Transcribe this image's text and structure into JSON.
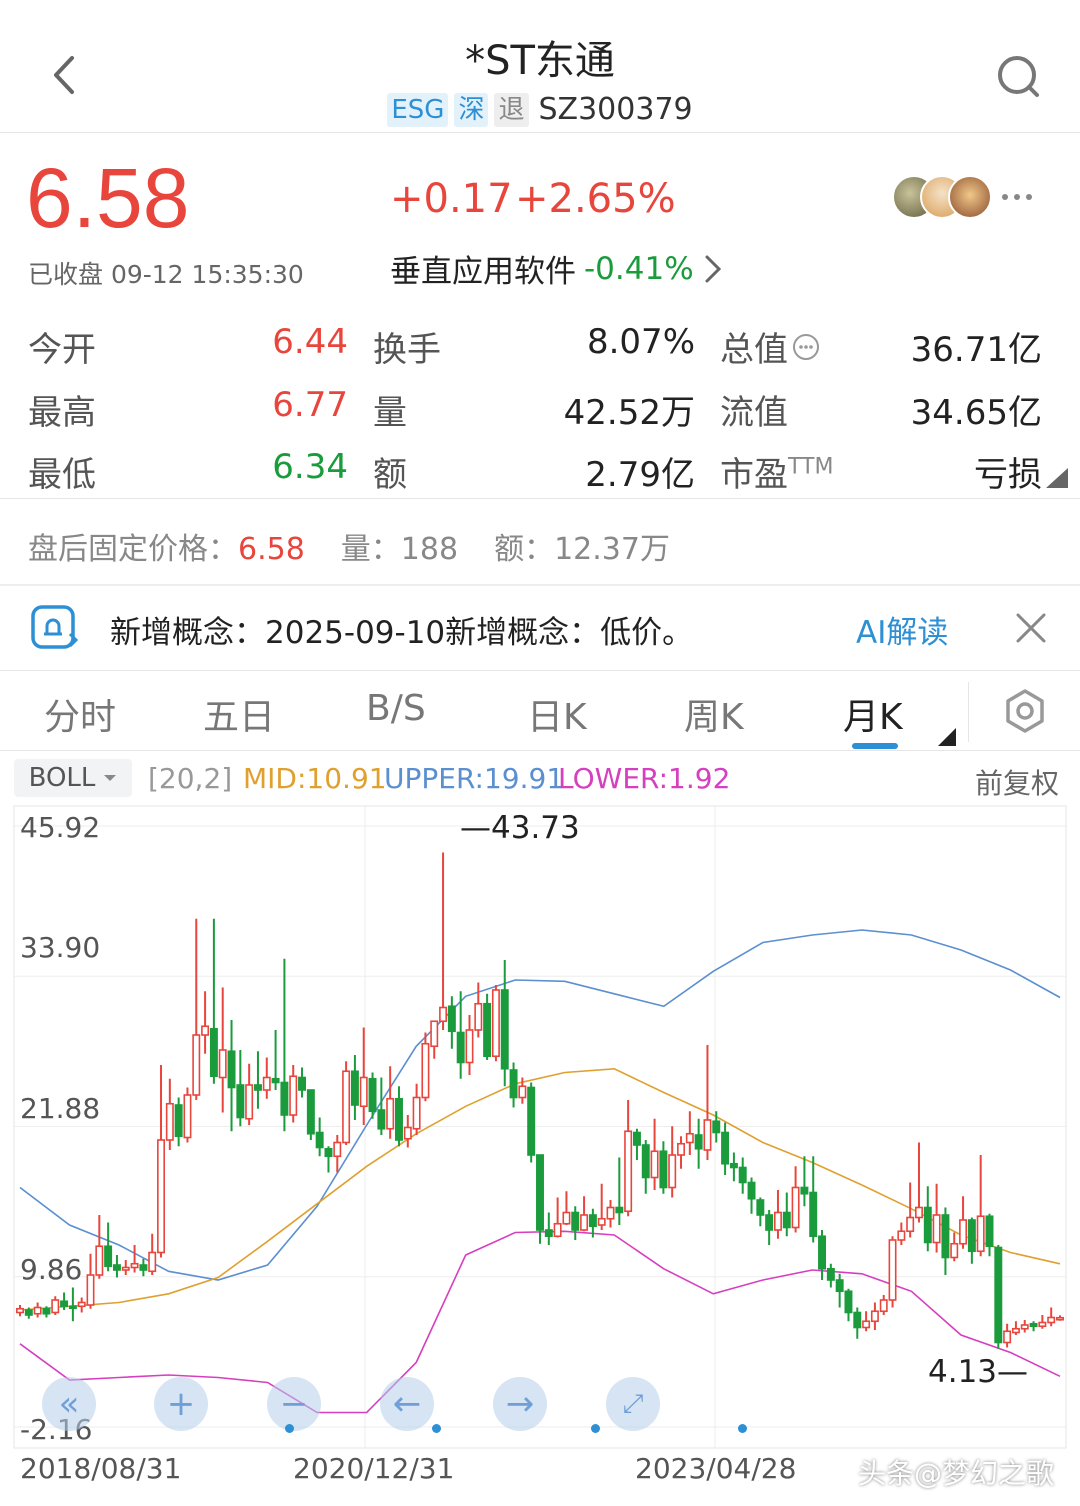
{
  "header": {
    "title": "*ST东通",
    "tags": [
      "ESG",
      "深",
      "退"
    ],
    "code": "SZ300379"
  },
  "quote": {
    "price": "6.58",
    "change": "+0.17",
    "change_pct": "+2.65%",
    "status": "已收盘 09-12 15:35:30",
    "sector_name": "垂直应用软件",
    "sector_change": "-0.41%"
  },
  "stats": [
    {
      "label": "今开",
      "value": "6.44",
      "color": "red"
    },
    {
      "label": "换手",
      "value": "8.07%",
      "color": "black"
    },
    {
      "label": "总值",
      "value": "36.71亿",
      "color": "black"
    },
    {
      "label": "最高",
      "value": "6.77",
      "color": "red"
    },
    {
      "label": "量",
      "value": "42.52万",
      "color": "black"
    },
    {
      "label": "流值",
      "value": "34.65亿",
      "color": "black"
    },
    {
      "label": "最低",
      "value": "6.34",
      "color": "green"
    },
    {
      "label": "额",
      "value": "2.79亿",
      "color": "black"
    },
    {
      "label": "市盈",
      "value": "亏损",
      "color": "black"
    }
  ],
  "ttm_sup": "TTM",
  "after_hours": {
    "label": "盘后固定价格：",
    "price": "6.58",
    "vol_label": "量：",
    "vol": "188",
    "amt_label": "额：",
    "amt": "12.37万"
  },
  "concept": {
    "text": "新增概念：2025-09-10新增概念：低价。",
    "ai_label": "AI解读"
  },
  "tabs": [
    "分时",
    "五日",
    "B/S",
    "日K",
    "周K",
    "月K"
  ],
  "active_tab": "月K",
  "indicator": {
    "name": "BOLL",
    "params": "[20,2]",
    "mid": "MID:10.91",
    "upper": "UPPER:19.91",
    "lower": "LOWER:1.92",
    "adjust": "前复权"
  },
  "colors": {
    "up": "#e8453c",
    "down": "#1a9b3c",
    "mid": "#e0a030",
    "upper": "#5b8fd0",
    "lower": "#d63fbf"
  },
  "chart_data": {
    "type": "candlestick",
    "y_ticks": [
      "45.92",
      "33.90",
      "21.88",
      "9.86",
      "-2.16"
    ],
    "ylim": [
      -2.16,
      45.92
    ],
    "x_ticks": [
      "2018/08/31",
      "2020/12/31",
      "2023/04/28"
    ],
    "max_label": "43.73",
    "min_label": "4.13",
    "candles": [
      [
        7.0,
        7.3,
        6.7,
        7.6
      ],
      [
        7.2,
        6.8,
        6.5,
        7.4
      ],
      [
        6.9,
        7.4,
        6.6,
        7.8
      ],
      [
        7.3,
        6.9,
        6.6,
        7.5
      ],
      [
        7.0,
        8.0,
        6.8,
        8.3
      ],
      [
        7.9,
        7.5,
        7.2,
        8.6
      ],
      [
        7.5,
        7.4,
        6.3,
        9.0
      ],
      [
        7.5,
        7.8,
        7.0,
        8.2
      ],
      [
        7.6,
        10.0,
        7.3,
        11.7
      ],
      [
        10.0,
        12.3,
        9.7,
        14.8
      ],
      [
        12.3,
        10.7,
        10.3,
        14.2
      ],
      [
        10.8,
        10.4,
        9.8,
        11.6
      ],
      [
        10.4,
        10.6,
        10.0,
        11.2
      ],
      [
        10.6,
        10.9,
        10.2,
        12.4
      ],
      [
        10.8,
        10.4,
        9.9,
        11.3
      ],
      [
        10.3,
        11.8,
        10.0,
        13.3
      ],
      [
        11.8,
        20.8,
        11.4,
        26.8
      ],
      [
        20.8,
        23.7,
        20.0,
        25.7
      ],
      [
        23.6,
        21.1,
        20.3,
        24.2
      ],
      [
        21.0,
        24.4,
        20.6,
        25.0
      ],
      [
        24.4,
        29.2,
        24.0,
        38.5
      ],
      [
        29.2,
        29.9,
        27.7,
        32.7
      ],
      [
        29.7,
        25.9,
        25.3,
        38.5
      ],
      [
        25.8,
        28.0,
        23.0,
        33.0
      ],
      [
        27.9,
        25.0,
        21.5,
        30.4
      ],
      [
        25.2,
        22.6,
        21.9,
        28.0
      ],
      [
        22.5,
        25.2,
        22.0,
        26.9
      ],
      [
        25.2,
        24.8,
        23.3,
        27.9
      ],
      [
        24.8,
        25.8,
        24.1,
        27.4
      ],
      [
        25.7,
        25.4,
        24.8,
        29.6
      ],
      [
        25.4,
        22.8,
        21.5,
        35.3
      ],
      [
        22.8,
        25.9,
        22.2,
        26.8
      ],
      [
        25.8,
        24.8,
        24.2,
        26.6
      ],
      [
        24.8,
        21.3,
        20.8,
        24.7
      ],
      [
        21.4,
        20.2,
        19.5,
        22.6
      ],
      [
        20.1,
        19.5,
        18.2,
        20.3
      ],
      [
        19.5,
        20.6,
        18.2,
        21.2
      ],
      [
        20.6,
        26.3,
        20.4,
        27.1
      ],
      [
        26.3,
        23.6,
        22.4,
        27.6
      ],
      [
        23.5,
        25.8,
        22.0,
        29.8
      ],
      [
        25.7,
        23.1,
        22.5,
        26.2
      ],
      [
        23.2,
        21.7,
        21.2,
        25.8
      ],
      [
        21.7,
        24.1,
        20.9,
        26.7
      ],
      [
        24.1,
        20.8,
        20.3,
        25.1
      ],
      [
        20.9,
        21.8,
        20.2,
        22.8
      ],
      [
        21.7,
        24.2,
        21.2,
        25.3
      ],
      [
        24.2,
        28.5,
        23.9,
        29.4
      ],
      [
        28.3,
        30.3,
        27.3,
        30.3
      ],
      [
        30.3,
        31.4,
        29.6,
        43.8
      ],
      [
        31.5,
        29.5,
        28.1,
        32.3
      ],
      [
        29.4,
        27.0,
        25.7,
        32.7
      ],
      [
        27.0,
        29.6,
        26.0,
        30.8
      ],
      [
        29.6,
        31.7,
        29.0,
        33.4
      ],
      [
        31.7,
        27.5,
        27.2,
        32.5
      ],
      [
        27.5,
        32.8,
        27.1,
        33.2
      ],
      [
        32.8,
        26.5,
        25.1,
        35.2
      ],
      [
        26.4,
        24.2,
        23.4,
        27.0
      ],
      [
        24.2,
        25.1,
        23.7,
        25.8
      ],
      [
        25.0,
        19.6,
        19.0,
        25.4
      ],
      [
        19.6,
        13.6,
        12.5,
        19.6
      ],
      [
        13.6,
        13.1,
        12.4,
        15.0
      ],
      [
        13.1,
        14.1,
        13.0,
        16.2
      ],
      [
        14.1,
        15.0,
        14.0,
        16.7
      ],
      [
        15.0,
        13.6,
        12.8,
        15.5
      ],
      [
        13.6,
        14.8,
        13.5,
        16.3
      ],
      [
        14.8,
        13.9,
        13.0,
        15.3
      ],
      [
        14.0,
        14.5,
        13.6,
        17.3
      ],
      [
        14.5,
        15.4,
        13.8,
        16.0
      ],
      [
        15.4,
        15.0,
        14.0,
        19.4
      ],
      [
        15.1,
        21.5,
        14.7,
        24.0
      ],
      [
        21.4,
        20.4,
        19.2,
        21.7
      ],
      [
        20.4,
        17.8,
        16.5,
        20.8
      ],
      [
        17.8,
        19.9,
        16.8,
        22.5
      ],
      [
        19.9,
        17.0,
        16.5,
        20.7
      ],
      [
        17.0,
        19.6,
        16.2,
        21.9
      ],
      [
        19.6,
        20.5,
        18.5,
        21.1
      ],
      [
        20.6,
        21.3,
        19.6,
        23.1
      ],
      [
        21.2,
        20.1,
        18.5,
        22.5
      ],
      [
        20.0,
        22.4,
        19.2,
        28.4
      ],
      [
        22.3,
        21.4,
        20.6,
        23.1
      ],
      [
        21.4,
        18.9,
        18.0,
        22.2
      ],
      [
        18.9,
        18.6,
        17.5,
        19.8
      ],
      [
        18.6,
        17.4,
        16.5,
        19.4
      ],
      [
        17.4,
        16.1,
        14.9,
        17.8
      ],
      [
        16.0,
        14.8,
        13.9,
        16.2
      ],
      [
        14.8,
        13.6,
        12.4,
        15.2
      ],
      [
        13.6,
        15.0,
        12.9,
        16.8
      ],
      [
        15.0,
        13.8,
        13.1,
        16.6
      ],
      [
        13.8,
        17.0,
        13.4,
        18.7
      ],
      [
        17.0,
        16.5,
        15.5,
        19.5
      ],
      [
        16.6,
        13.1,
        12.6,
        19.5
      ],
      [
        13.1,
        10.5,
        9.6,
        13.6
      ],
      [
        10.5,
        9.6,
        9.0,
        10.9
      ],
      [
        9.6,
        8.7,
        7.4,
        10.1
      ],
      [
        8.7,
        7.0,
        6.3,
        8.9
      ],
      [
        7.0,
        5.8,
        4.9,
        7.4
      ],
      [
        5.8,
        6.3,
        5.5,
        7.1
      ],
      [
        6.3,
        7.1,
        5.6,
        7.8
      ],
      [
        7.1,
        8.0,
        6.8,
        8.4
      ],
      [
        8.0,
        12.8,
        7.4,
        13.1
      ],
      [
        12.8,
        13.5,
        12.4,
        14.2
      ],
      [
        13.5,
        14.6,
        13.0,
        17.4
      ],
      [
        14.6,
        15.4,
        14.2,
        20.6
      ],
      [
        15.4,
        12.6,
        11.9,
        17.1
      ],
      [
        12.6,
        14.8,
        11.8,
        17.3
      ],
      [
        14.8,
        11.4,
        10.0,
        15.4
      ],
      [
        11.4,
        12.5,
        11.1,
        13.4
      ],
      [
        12.5,
        14.4,
        12.1,
        16.3
      ],
      [
        14.4,
        11.9,
        10.9,
        14.6
      ],
      [
        11.9,
        14.7,
        11.5,
        19.6
      ],
      [
        14.7,
        12.3,
        11.5,
        14.9
      ],
      [
        12.2,
        4.6,
        4.1,
        12.4
      ],
      [
        4.6,
        5.5,
        4.2,
        6.1
      ],
      [
        5.4,
        5.7,
        5.2,
        6.3
      ],
      [
        5.7,
        6.0,
        5.4,
        6.4
      ],
      [
        6.1,
        5.9,
        5.5,
        6.3
      ],
      [
        5.9,
        6.2,
        5.7,
        6.8
      ],
      [
        6.2,
        6.6,
        5.9,
        7.4
      ],
      [
        6.5,
        6.58,
        6.34,
        6.77
      ]
    ],
    "upper": [
      17.0,
      14.0,
      12.4,
      10.3,
      9.6,
      10.8,
      15.5,
      22.0,
      28.3,
      32.3,
      33.6,
      33.5,
      32.5,
      31.5,
      34.3,
      36.6,
      37.2,
      37.6,
      37.2,
      36.0,
      34.4,
      32.2
    ],
    "mid": [
      7.2,
      7.5,
      7.8,
      8.5,
      9.8,
      12.7,
      15.7,
      18.7,
      21.3,
      23.5,
      25.3,
      26.2,
      26.5,
      24.6,
      22.8,
      20.6,
      19.0,
      17.2,
      15.3,
      13.2,
      11.8,
      10.9
    ],
    "lower": [
      4.5,
      1.6,
      1.8,
      2.0,
      1.8,
      1.4,
      -1.0,
      -1.0,
      3.0,
      11.6,
      13.4,
      13.5,
      13.2,
      10.5,
      8.5,
      9.6,
      10.4,
      10.1,
      8.7,
      5.2,
      3.8,
      1.9
    ]
  },
  "watermark": "头条@梦幻之歌"
}
